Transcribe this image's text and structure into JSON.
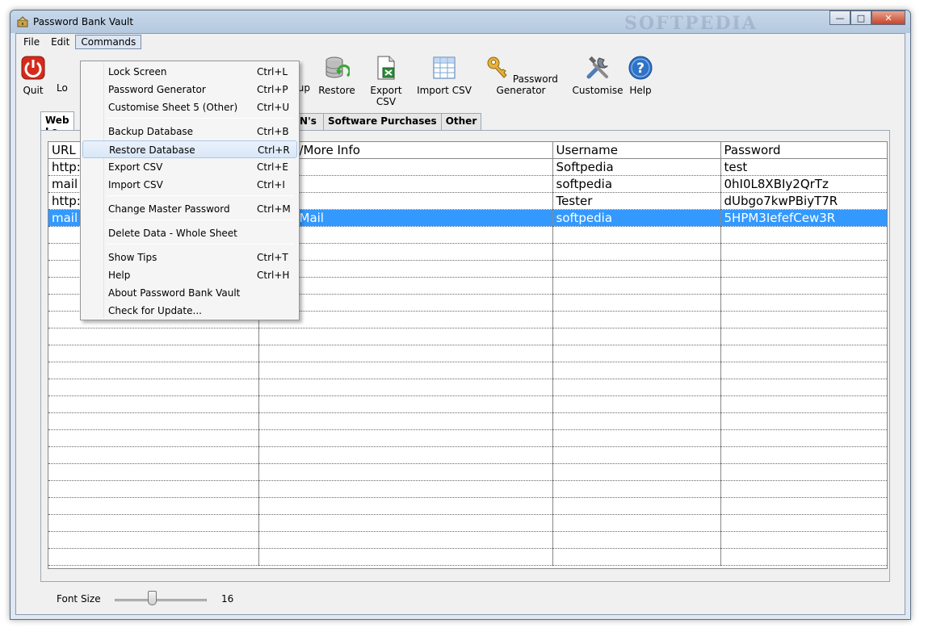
{
  "window": {
    "title": "Password Bank Vault",
    "watermark": "SOFTPEDIA"
  },
  "menubar": {
    "file": "File",
    "edit": "Edit",
    "commands": "Commands"
  },
  "toolbar": {
    "quit": "Quit",
    "lock": "Lo",
    "backup": "up",
    "restore": "Restore",
    "export_csv": "Export CSV",
    "import_csv": "Import CSV",
    "password_generator": "Password Generator",
    "customise": "Customise",
    "help": "Help",
    "help_glyph": "?"
  },
  "tabs": {
    "web_logins": "Web Lo",
    "pins": "d PIN's",
    "software_purchases": "Software Purchases",
    "other": "Other"
  },
  "table": {
    "headers": {
      "url": "URL",
      "info": "/More Info",
      "username": "Username",
      "password": "Password"
    },
    "rows": [
      {
        "url": "http:",
        "info": "",
        "username": "Softpedia",
        "password": "test"
      },
      {
        "url": "mail",
        "info": "",
        "username": "softpedia",
        "password": "0hI0L8XBIy2QrTz"
      },
      {
        "url": "http:",
        "info": "",
        "username": "Tester",
        "password": "dUbgo7kwPBiyT7R"
      },
      {
        "url": "mail",
        "info": "Mail",
        "username": "softpedia",
        "password": "5HPM3IefefCew3R"
      }
    ]
  },
  "footer": {
    "font_size_label": "Font Size",
    "font_size_value": "16",
    "font_size_fraction": 0.4
  },
  "commands_menu": [
    {
      "label": "Lock Screen",
      "shortcut": "Ctrl+L"
    },
    {
      "label": "Password Generator",
      "shortcut": "Ctrl+P"
    },
    {
      "label": "Customise Sheet 5 (Other)",
      "shortcut": "Ctrl+U"
    },
    {
      "label": "Backup Database",
      "shortcut": "Ctrl+B"
    },
    {
      "label": "Restore Database",
      "shortcut": "Ctrl+R"
    },
    {
      "label": "Export CSV",
      "shortcut": "Ctrl+E"
    },
    {
      "label": "Import CSV",
      "shortcut": "Ctrl+I"
    },
    {
      "label": "Change Master Password",
      "shortcut": "Ctrl+M"
    },
    {
      "label": "Delete Data - Whole Sheet",
      "shortcut": ""
    },
    {
      "label": "Show Tips",
      "shortcut": "Ctrl+T"
    },
    {
      "label": "Help",
      "shortcut": "Ctrl+H"
    },
    {
      "label": "About Password Bank Vault",
      "shortcut": ""
    },
    {
      "label": "Check for Update...",
      "shortcut": ""
    }
  ],
  "colors": {
    "selection": "#3399ff",
    "quit_red": "#d62a1a",
    "help_blue": "#2f73c8"
  }
}
